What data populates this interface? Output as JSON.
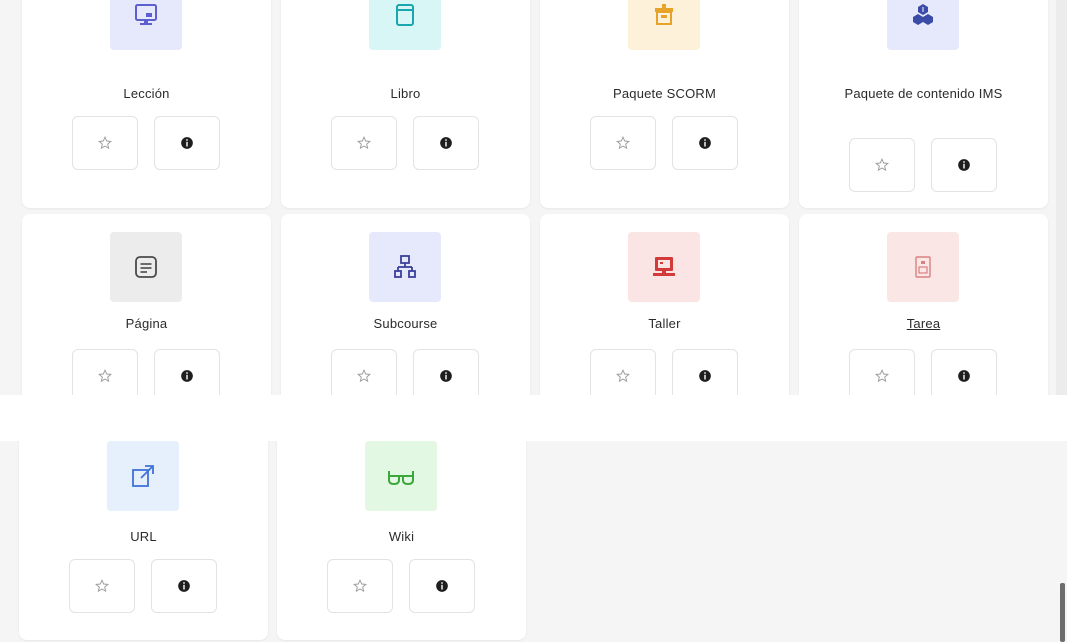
{
  "modules": [
    {
      "name": "Lección",
      "icon": "monitor-lesson-icon",
      "tile_bg": "#e6e9fb",
      "icon_color": "#5b5fd0"
    },
    {
      "name": "Libro",
      "icon": "book-icon",
      "tile_bg": "#d9f6f7",
      "icon_color": "#1aa6ae"
    },
    {
      "name": "Paquete SCORM",
      "icon": "package-box-icon",
      "tile_bg": "#fdf1da",
      "icon_color": "#e7a22a"
    },
    {
      "name": "Paquete de contenido IMS",
      "icon": "cubes-icon",
      "tile_bg": "#e6e9fb",
      "icon_color": "#3a4ba8"
    },
    {
      "name": "Página",
      "icon": "page-icon",
      "tile_bg": "#ececec",
      "icon_color": "#4a4a4a"
    },
    {
      "name": "Subcourse",
      "icon": "subcourse-network-icon",
      "tile_bg": "#e6e9fb",
      "icon_color": "#3a3f9a"
    },
    {
      "name": "Taller",
      "icon": "workshop-icon",
      "tile_bg": "#fbe4e4",
      "icon_color": "#d33a3a"
    },
    {
      "name": "Tarea",
      "icon": "assignment-icon",
      "tile_bg": "#fbe6e6",
      "icon_color": "#d98080"
    },
    {
      "name": "URL",
      "icon": "external-link-icon",
      "tile_bg": "#e6effc",
      "icon_color": "#3f72d6"
    },
    {
      "name": "Wiki",
      "icon": "glasses-icon",
      "tile_bg": "#e2f8e2",
      "icon_color": "#3ba83b"
    }
  ],
  "actions": {
    "star_icon": "star-outline-icon",
    "info_icon": "info-icon",
    "star_color": "#9a9a9a",
    "info_color": "#1e1e1e"
  }
}
